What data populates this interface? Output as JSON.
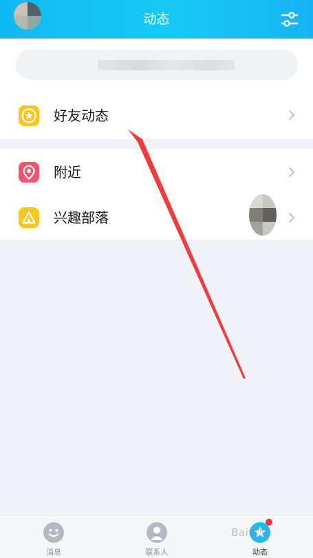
{
  "header": {
    "title": "动态",
    "filter_icon": "sliders-icon"
  },
  "search": {
    "placeholder": ""
  },
  "menu": {
    "friends_feed": {
      "label": "好友动态",
      "icon": "star-icon",
      "color": "#ffc51b"
    },
    "nearby": {
      "label": "附近",
      "icon": "location-pin-icon",
      "color": "#f0546a"
    },
    "interest_tribe": {
      "label": "兴趣部落",
      "icon": "tent-icon",
      "color": "#ffc51b"
    }
  },
  "tabbar": {
    "messages": {
      "label": "消息",
      "icon": "chat-smile-icon"
    },
    "contacts": {
      "label": "联系人",
      "icon": "person-icon"
    },
    "feed": {
      "label": "动态",
      "icon": "feed-star-icon",
      "active": true,
      "has_badge": true
    }
  },
  "watermark": {
    "text": "Bai经验"
  },
  "colors": {
    "header_gradient_start": "#11b9f2",
    "header_gradient_end": "#16b4f3",
    "background": "#f1f3f8",
    "badge": "#f5363a",
    "annotation_arrow": "#ef3c3c"
  }
}
